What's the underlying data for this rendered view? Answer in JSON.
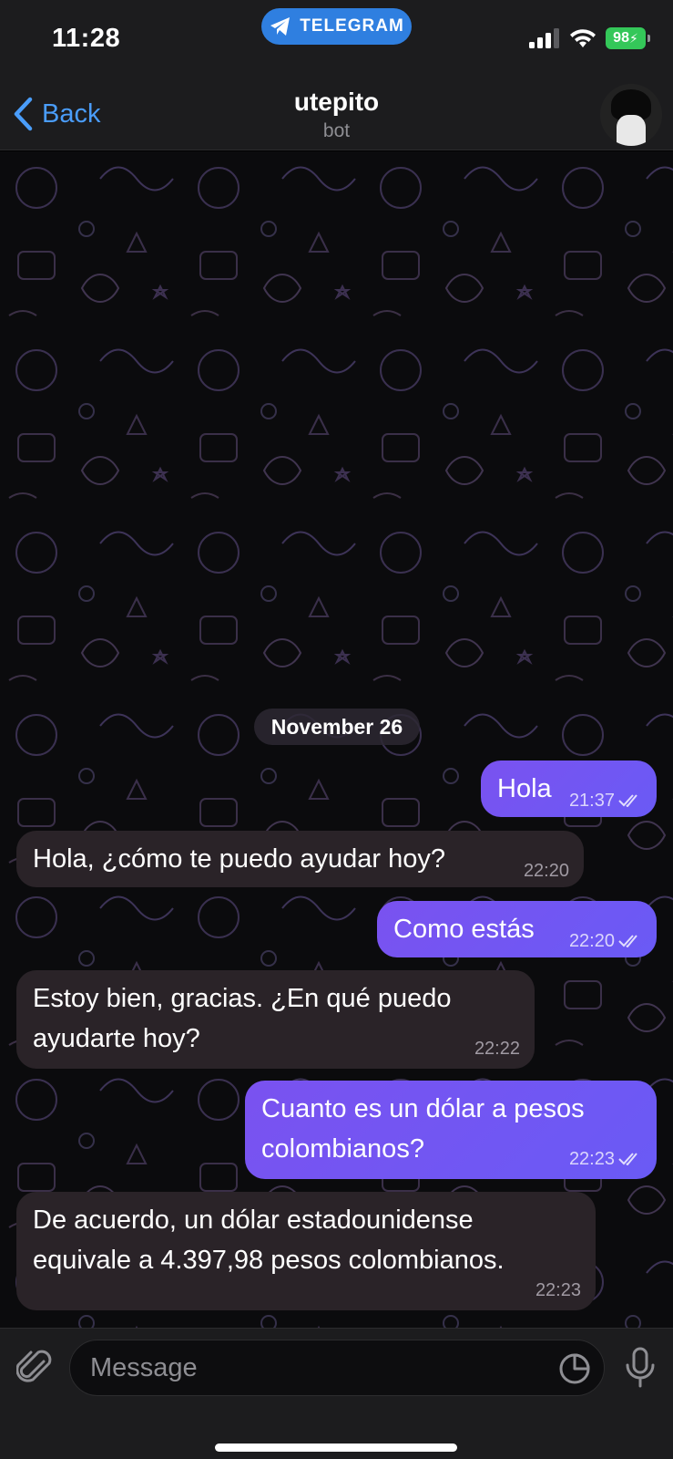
{
  "status_bar": {
    "time": "11:28",
    "app_pill": "TELEGRAM",
    "battery": "98"
  },
  "header": {
    "back_label": "Back",
    "title": "utepito",
    "subtitle": "bot"
  },
  "date_chip": "November 26",
  "messages": [
    {
      "direction": "out",
      "text": "Hola",
      "time": "21:37",
      "read": true
    },
    {
      "direction": "in",
      "text": "Hola, ¿cómo te puedo ayudar hoy?",
      "time": "22:20"
    },
    {
      "direction": "out",
      "text": "Como estás",
      "time": "22:20",
      "read": true
    },
    {
      "direction": "in",
      "text_lines": [
        "Estoy bien, gracias. ¿En qué puedo",
        "ayudarte hoy?"
      ],
      "time": "22:22"
    },
    {
      "direction": "out",
      "text_lines": [
        "Cuanto es un dólar a pesos",
        "colombianos?"
      ],
      "time": "22:23",
      "read": true
    },
    {
      "direction": "in",
      "text_lines": [
        "De acuerdo, un dólar estadounidense",
        "equivale a 4.397,98 pesos colombianos."
      ],
      "time": "22:23"
    }
  ],
  "input": {
    "placeholder": "Message"
  },
  "colors": {
    "outgoing_bubble": "#7a52f0",
    "incoming_bubble": "#2a2328",
    "accent": "#4a9dfa",
    "battery": "#34c759"
  },
  "icons": [
    "telegram-icon",
    "signal-icon",
    "wifi-icon",
    "battery-icon",
    "chevron-left-icon",
    "double-check-icon",
    "paperclip-icon",
    "sticker-icon",
    "microphone-icon"
  ]
}
